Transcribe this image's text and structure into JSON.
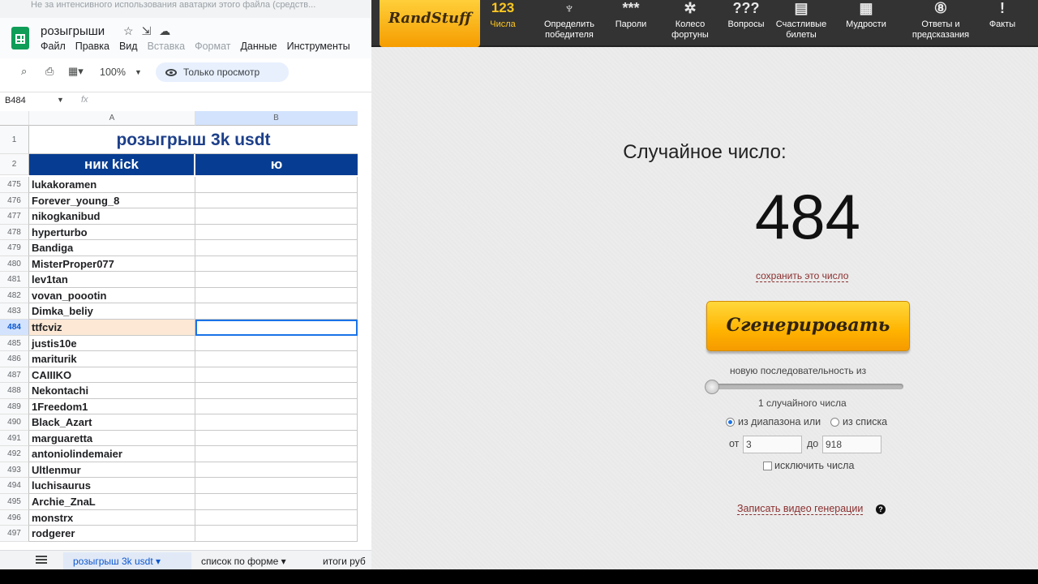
{
  "sheets": {
    "notice": "Не за интенсивного использования аватарки этого файла (средств...",
    "doc_title": "розыгрыши",
    "menu": [
      "Файл",
      "Правка",
      "Вид",
      "Вставка",
      "Формат",
      "Данные",
      "Инструменты"
    ],
    "zoom": "100%",
    "view_only": "Только просмотр",
    "name_box": "B484",
    "fx": "fx",
    "col_a": "A",
    "col_b": "B",
    "title": "розыгрыш 3k usdt",
    "header_nick": "ник kick",
    "header_b": "ю",
    "rows": [
      {
        "num": "1",
        "name": ""
      },
      {
        "num": "2",
        "name": ""
      },
      {
        "num": "475",
        "name": "lukakoramen"
      },
      {
        "num": "476",
        "name": "Forever_young_8"
      },
      {
        "num": "477",
        "name": "nikogkanibud"
      },
      {
        "num": "478",
        "name": "hyperturbo"
      },
      {
        "num": "479",
        "name": "Bandiga"
      },
      {
        "num": "480",
        "name": "MisterProper077"
      },
      {
        "num": "481",
        "name": "lev1tan"
      },
      {
        "num": "482",
        "name": "vovan_poootin"
      },
      {
        "num": "483",
        "name": "Dimka_beliy"
      },
      {
        "num": "484",
        "name": "ttfcviz"
      },
      {
        "num": "485",
        "name": "justis10e"
      },
      {
        "num": "486",
        "name": "mariturik"
      },
      {
        "num": "487",
        "name": "CAIIIKO"
      },
      {
        "num": "488",
        "name": "Nekontachi"
      },
      {
        "num": "489",
        "name": "1Freedom1"
      },
      {
        "num": "490",
        "name": "Black_Azart"
      },
      {
        "num": "491",
        "name": "marguaretta"
      },
      {
        "num": "492",
        "name": "antoniolindemaier"
      },
      {
        "num": "493",
        "name": "Ultlenmur"
      },
      {
        "num": "494",
        "name": "luchisaurus"
      },
      {
        "num": "495",
        "name": "Archie_ZnaL"
      },
      {
        "num": "496",
        "name": "monstrx"
      },
      {
        "num": "497",
        "name": "rodgerer"
      }
    ],
    "tabs": [
      "розыгрыш 3k usdt",
      "список по форме",
      "итоги руб"
    ]
  },
  "rand": {
    "logo": "RandStuff",
    "nav": [
      {
        "icon": "123",
        "label": "Числа",
        "icon_name": "numbers-icon"
      },
      {
        "icon": "♆",
        "label": "Определить победителя",
        "icon_name": "trophy-icon"
      },
      {
        "icon": "***",
        "label": "Пароли",
        "icon_name": "password-icon"
      },
      {
        "icon": "✲",
        "label": "Колесо фортуны",
        "icon_name": "wheel-icon"
      },
      {
        "icon": "???",
        "label": "Вопросы",
        "icon_name": "questions-icon"
      },
      {
        "icon": "▤",
        "label": "Счастливые билеты",
        "icon_name": "ticket-icon"
      },
      {
        "icon": "▦",
        "label": "Мудрости",
        "icon_name": "wisdom-icon"
      },
      {
        "icon": "⑧",
        "label": "Ответы и предсказания",
        "icon_name": "magic-ball-icon"
      },
      {
        "icon": "!",
        "label": "Факты",
        "icon_name": "facts-icon"
      }
    ],
    "title": "Случайное число:",
    "number": "484",
    "save_link": "сохранить это число",
    "generate": "Сгенерировать",
    "sequence_label": "новую последовательность из",
    "count_label": "1 случайного числа",
    "opt_range": "из диапазона или",
    "opt_list": "из списка",
    "from_label": "от",
    "from_value": "3",
    "to_label": "до",
    "to_value": "918",
    "exclude_label": "исключить числа",
    "video_link": "Записать видео генерации",
    "help": "?"
  }
}
